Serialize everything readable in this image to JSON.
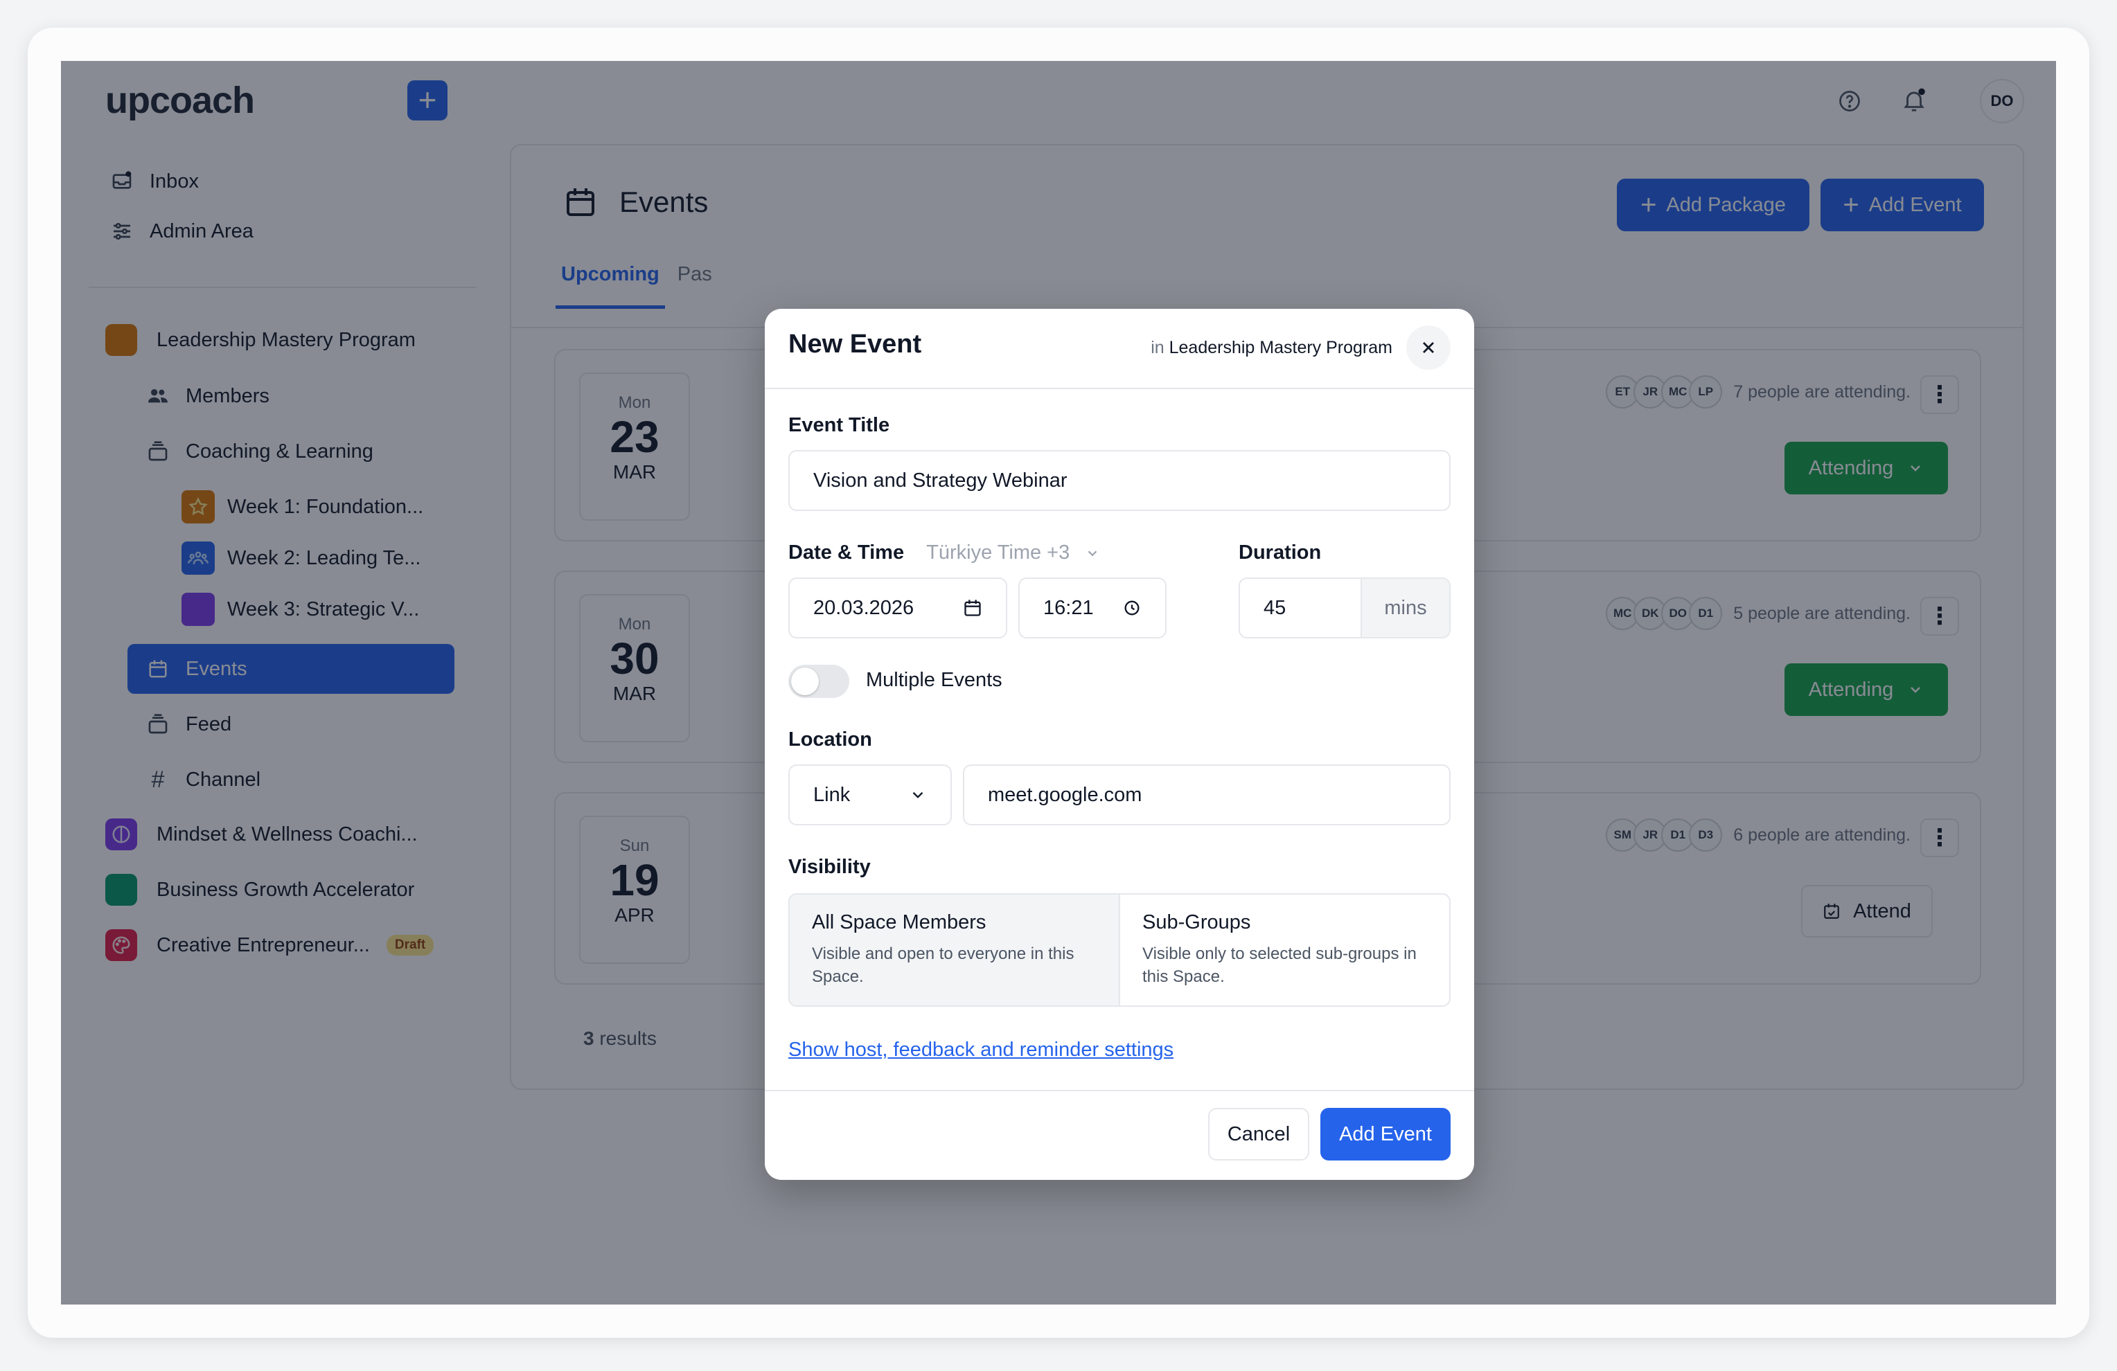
{
  "sidebar": {
    "logo": "upcoach",
    "inbox": "Inbox",
    "admin": "Admin Area",
    "programs": [
      {
        "name": "Leadership Mastery Program",
        "color": "#d97706"
      },
      {
        "name": "Mindset & Wellness Coachi...",
        "color": "#7c3aed"
      },
      {
        "name": "Business Growth Accelerator",
        "color": "#059669"
      },
      {
        "name": "Creative Entrepreneur...",
        "color": "#e11d48",
        "badge": "Draft"
      }
    ],
    "members": "Members",
    "coaching": "Coaching & Learning",
    "weeks": [
      "Week 1: Foundation...",
      "Week 2: Leading Te...",
      "Week 3: Strategic V..."
    ],
    "events": "Events",
    "feed": "Feed",
    "channel": "Channel"
  },
  "header": {
    "avatar": "DO"
  },
  "main": {
    "title": "Events",
    "add_package": "Add Package",
    "add_event": "Add Event",
    "tabs": [
      "Upcoming",
      "Pas"
    ],
    "events": [
      {
        "dow": "Mon",
        "day": "23",
        "mon": "MAR",
        "avatars": [
          "ET",
          "JR",
          "MC",
          "LP"
        ],
        "attending_text": "7 people are attending.",
        "action": "Attending"
      },
      {
        "dow": "Mon",
        "day": "30",
        "mon": "MAR",
        "avatars": [
          "MC",
          "DK",
          "DO",
          "D1"
        ],
        "attending_text": "5 people are attending.",
        "action": "Attending"
      },
      {
        "dow": "Sun",
        "day": "19",
        "mon": "APR",
        "avatars": [
          "SM",
          "JR",
          "D1",
          "D3"
        ],
        "attending_text": "6 people are attending.",
        "action": "Attend"
      }
    ],
    "results_count": "3",
    "results_label": "results"
  },
  "modal": {
    "title": "New Event",
    "in_prefix": "in",
    "in_program": "Leadership Mastery Program",
    "event_title_label": "Event Title",
    "event_title_value": "Vision and Strategy Webinar",
    "datetime_label": "Date & Time",
    "timezone": "Türkiye Time +3",
    "date_value": "20.03.2026",
    "time_value": "16:21",
    "duration_label": "Duration",
    "duration_value": "45",
    "duration_unit": "mins",
    "multiple_events_label": "Multiple Events",
    "location_label": "Location",
    "location_type": "Link",
    "location_value": "meet.google.com",
    "visibility_label": "Visibility",
    "visibility_options": [
      {
        "title": "All Space Members",
        "desc": "Visible and open to everyone in this Space."
      },
      {
        "title": "Sub-Groups",
        "desc": "Visible only to selected sub-groups in this Space."
      }
    ],
    "settings_link": "Show host, feedback and reminder settings",
    "cancel": "Cancel",
    "submit": "Add Event"
  }
}
